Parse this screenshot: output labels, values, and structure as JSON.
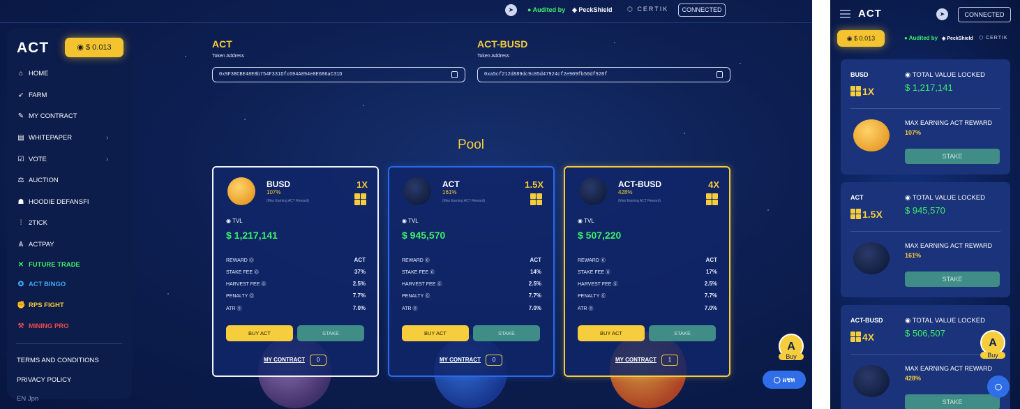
{
  "topbar": {
    "telegram_icon": "telegram-icon",
    "audited_prefix": "Audited by",
    "peckshield": "PeckShield",
    "certik": "CERTIK",
    "connected": "CONNECTED"
  },
  "sidebar": {
    "logo": "ACT",
    "price": "$ 0.013",
    "items": [
      {
        "label": "HOME",
        "icon": "home-icon"
      },
      {
        "label": "FARM",
        "icon": "rocket-icon"
      },
      {
        "label": "MY CONTRACT",
        "icon": "contract-icon"
      },
      {
        "label": "WHITEPAPER",
        "icon": "book-icon"
      },
      {
        "label": "VOTE",
        "icon": "vote-icon"
      },
      {
        "label": "AUCTION",
        "icon": "gavel-icon"
      },
      {
        "label": "HOODIE DEFANSFI",
        "icon": "hoodie-icon"
      },
      {
        "label": "2TICK",
        "icon": "2tick-icon"
      },
      {
        "label": "ACTPAY",
        "icon": "actpay-icon"
      },
      {
        "label": "FUTURE TRADE",
        "icon": "future-trade-icon",
        "color": "#3cf06a"
      },
      {
        "label": "ACT BINGO",
        "icon": "bingo-icon",
        "color": "#3fa9f5"
      },
      {
        "label": "RPS FIGHT",
        "icon": "rps-icon",
        "color": "#f6cd3c"
      },
      {
        "label": "MINING PRO",
        "icon": "mining-icon",
        "color": "#f04a4a"
      }
    ],
    "footer": [
      "TERMS AND CONDITIONS",
      "PRIVACY POLICY"
    ],
    "lang": "EN   Jpn"
  },
  "tokens": [
    {
      "name": "ACT",
      "sub": "Token Address",
      "address": "0x9F3BCBE48E8b754F331Dfc694A894e8E686aC31D"
    },
    {
      "name": "ACT-BUSD",
      "sub": "Token Address",
      "address": "0xa5cf212d889dc9c05d47924cf2e909fb50df928f"
    }
  ],
  "pool_title": "Pool",
  "pools": [
    {
      "name": "BUSD",
      "pct": "107%",
      "small": "(Max Earning ACT Reward)",
      "mult": "1X",
      "tvl_label": "TVL",
      "tvl": "$ 1,217,141",
      "rows": [
        {
          "k": "REWARD",
          "v": "ACT"
        },
        {
          "k": "STAKE FEE",
          "v": "37%"
        },
        {
          "k": "HARVEST FEE",
          "v": "2.5%"
        },
        {
          "k": "PENALTY",
          "v": "7.7%"
        },
        {
          "k": "ATR",
          "v": "7.0%"
        }
      ],
      "buy": "BUY ACT",
      "stake": "STAKE",
      "my_contract": "MY CONTRACT",
      "count": "0"
    },
    {
      "name": "ACT",
      "pct": "161%",
      "small": "(Max Earning ACT Reward)",
      "mult": "1.5X",
      "tvl_label": "TVL",
      "tvl": "$ 945,570",
      "rows": [
        {
          "k": "REWARD",
          "v": "ACT"
        },
        {
          "k": "STAKE FEE",
          "v": "14%"
        },
        {
          "k": "HARVEST FEE",
          "v": "2.5%"
        },
        {
          "k": "PENALTY",
          "v": "7.7%"
        },
        {
          "k": "ATR",
          "v": "7.0%"
        }
      ],
      "buy": "BUY ACT",
      "stake": "STAKE",
      "my_contract": "MY CONTRACT",
      "count": "0"
    },
    {
      "name": "ACT-BUSD",
      "pct": "428%",
      "small": "(Max Earning ACT Reward)",
      "mult": "4X",
      "tvl_label": "TVL",
      "tvl": "$ 507,220",
      "rows": [
        {
          "k": "REWARD",
          "v": "ACT"
        },
        {
          "k": "STAKE FEE",
          "v": "17%"
        },
        {
          "k": "HARVEST FEE",
          "v": "2.5%"
        },
        {
          "k": "PENALTY",
          "v": "7.7%"
        },
        {
          "k": "ATR",
          "v": "7.0%"
        }
      ],
      "buy": "BUY ACT",
      "stake": "STAKE",
      "my_contract": "MY CONTRACT",
      "count": "1"
    }
  ],
  "float": {
    "buy": "Buy",
    "chat": "แชท"
  },
  "mobile": {
    "logo": "ACT",
    "connected": "CONNECTED",
    "price": "$ 0.013",
    "audited": "Audited by",
    "peckshield": "PeckShield",
    "certik": "CERTIK",
    "cards": [
      {
        "name": "BUSD",
        "mult": "1X",
        "tvl_label": "TOTAL VALUE LOCKED",
        "tvl": "$ 1,217,141",
        "max": "MAX EARNING ACT REWARD",
        "pct": "107%",
        "stake": "STAKE"
      },
      {
        "name": "ACT",
        "mult": "1.5X",
        "tvl_label": "TOTAL VALUE LOCKED",
        "tvl": "$ 945,570",
        "max": "MAX EARNING ACT REWARD",
        "pct": "161%",
        "stake": "STAKE"
      },
      {
        "name": "ACT-BUSD",
        "mult": "4X",
        "tvl_label": "TOTAL VALUE LOCKED",
        "tvl": "$ 506,507",
        "max": "MAX EARNING ACT REWARD",
        "pct": "428%",
        "stake": "STAKE"
      }
    ],
    "buy": "Buy"
  }
}
